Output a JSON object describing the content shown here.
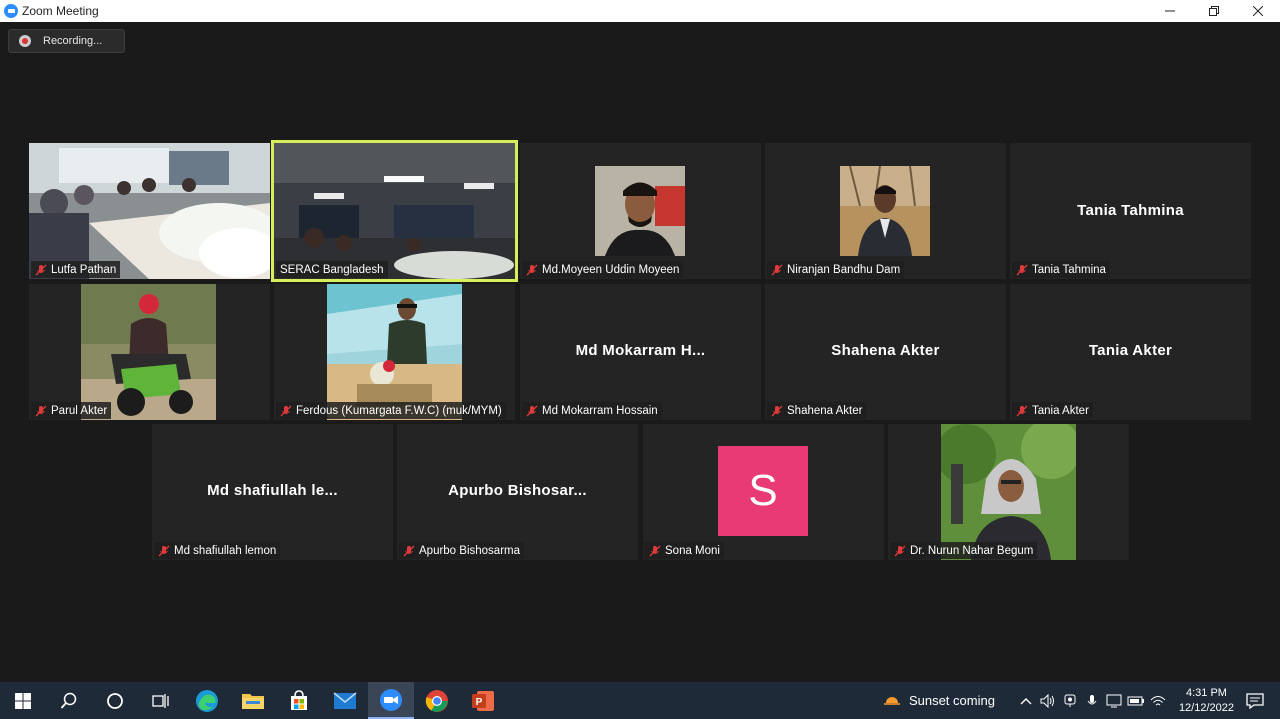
{
  "window": {
    "title": "Zoom Meeting"
  },
  "recording": {
    "label": "Recording..."
  },
  "participants": [
    {
      "display_name": "Lutfa Pathan",
      "center_name": "",
      "muted": true
    },
    {
      "display_name": "SERAC Bangladesh",
      "center_name": "",
      "muted": false,
      "active_speaker": true
    },
    {
      "display_name": "Md.Moyeen Uddin Moyeen",
      "center_name": "",
      "muted": true
    },
    {
      "display_name": "Niranjan Bandhu Dam",
      "center_name": "",
      "muted": true
    },
    {
      "display_name": "Tania Tahmina",
      "center_name": "Tania Tahmina",
      "muted": true
    },
    {
      "display_name": "Parul Akter",
      "center_name": "",
      "muted": true
    },
    {
      "display_name": "Ferdous (Kumargata F.W.C) (muk/MYM)",
      "center_name": "",
      "muted": true
    },
    {
      "display_name": "Md Mokarram Hossain",
      "center_name": "Md  Mokarram  H...",
      "muted": true
    },
    {
      "display_name": "Shahena Akter",
      "center_name": "Shahena Akter",
      "muted": true
    },
    {
      "display_name": "Tania Akter",
      "center_name": "Tania Akter",
      "muted": true
    },
    {
      "display_name": "Md shafiullah lemon",
      "center_name": "Md  shafiullah  le...",
      "muted": true
    },
    {
      "display_name": "Apurbo Bishosarma",
      "center_name": "Apurbo  Bishosar...",
      "muted": true
    },
    {
      "display_name": "Sona Moni",
      "center_name": "",
      "avatar_letter": "S",
      "avatar_color": "#e83a74",
      "muted": true
    },
    {
      "display_name": "Dr. Nurun Nahar Begum",
      "center_name": "",
      "muted": true
    }
  ],
  "taskbar": {
    "apps": [
      "windows-start",
      "search",
      "cortana",
      "task-view",
      "edge",
      "file-explorer",
      "microsoft-store",
      "mail",
      "zoom",
      "chrome",
      "powerpoint"
    ],
    "weather_text": "Sunset coming",
    "time": "4:31 PM",
    "date": "12/12/2022"
  },
  "colors": {
    "active_speaker_border": "#d6ee5a",
    "mic_muted": "#e03a3a",
    "taskbar_bg": "#1f2a38"
  }
}
